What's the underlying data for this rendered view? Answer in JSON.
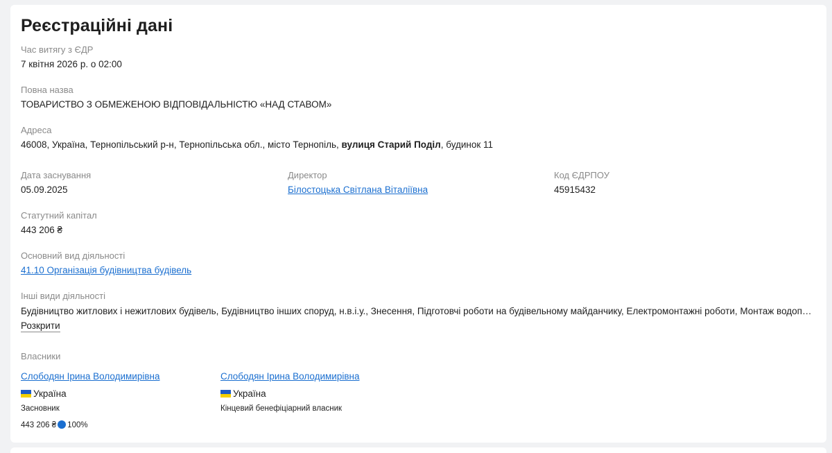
{
  "section": {
    "title": "Реєстраційні дані"
  },
  "extract_time": {
    "label": "Час витягу з ЄДР",
    "value": "7 квітня 2026 р. о 02:00"
  },
  "full_name": {
    "label": "Повна назва",
    "value": "ТОВАРИСТВО З ОБМЕЖЕНОЮ ВІДПОВІДАЛЬНІСТЮ «НАД СТАВОМ»"
  },
  "address": {
    "label": "Адреса",
    "prefix": "46008, Україна, Тернопільський р-н, Тернопільська обл., місто Тернопіль, ",
    "street": "вулиця Старий Поділ",
    "suffix": ", будинок 11"
  },
  "founded": {
    "label": "Дата заснування",
    "value": "05.09.2025"
  },
  "director": {
    "label": "Директор",
    "value": "Білостоцька Світлана Віталіївна"
  },
  "edrpou": {
    "label": "Код ЄДРПОУ",
    "value": "45915432"
  },
  "capital": {
    "label": "Статутний капітал",
    "value": "443 206 ₴"
  },
  "main_activity": {
    "label": "Основний вид діяльності",
    "value": "41.10 Організація будівництва будівель"
  },
  "other_activities": {
    "label": "Інші види діяльності",
    "value": "Будівництво житлових і нежитлових будівель, Будівництво інших споруд, н.в.і.у., Знесення, Підготовчі роботи на будівельному майданчику, Електромонтажні роботи, Монтаж водопровідних мереж, систем опалення та кондиціонування",
    "expand_label": "Розкрити"
  },
  "owners": {
    "label": "Власники",
    "items": [
      {
        "name": "Слободян Ірина Володимирівна",
        "country": "Україна",
        "role": "Засновник",
        "amount": "443 206 ₴",
        "share": "100%"
      },
      {
        "name": "Слободян Ірина Володимирівна",
        "country": "Україна",
        "role": "Кінцевий бенефіціарний власник"
      }
    ]
  },
  "colors": {
    "link": "#1b6fd0",
    "flag_blue": "#1e5bc6",
    "flag_yellow": "#f5d000",
    "label": "#8a8a8a"
  },
  "icons": {
    "flag": "ukraine-flag-icon",
    "share": "share-dot-icon"
  }
}
